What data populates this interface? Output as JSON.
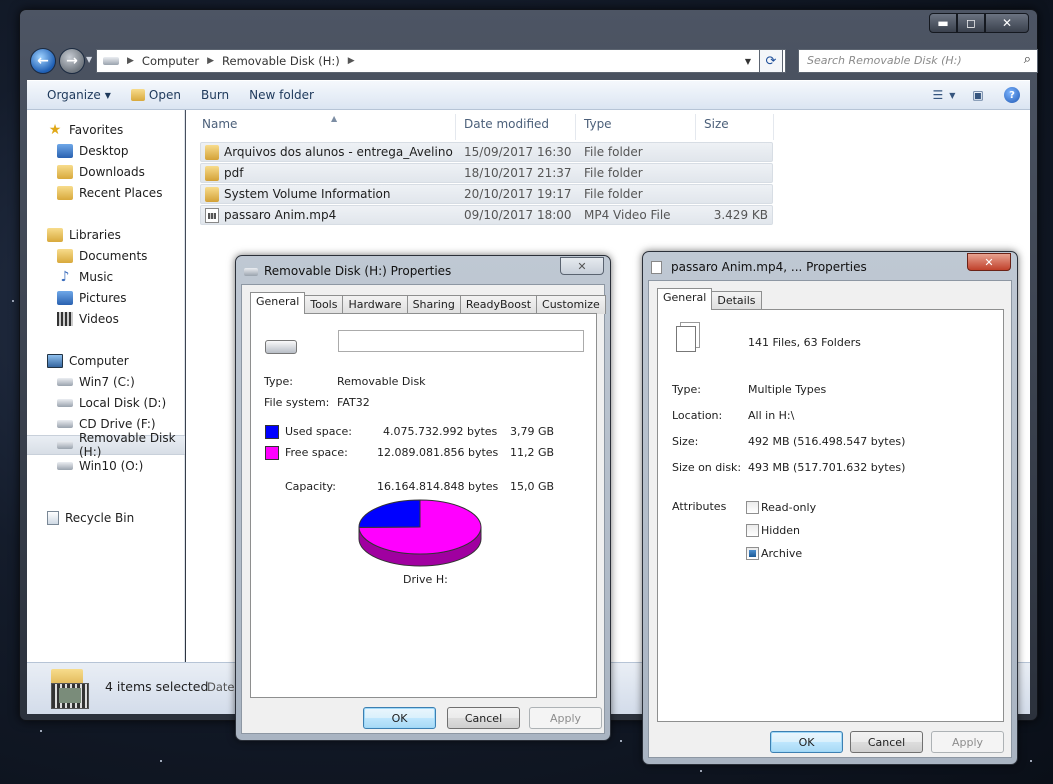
{
  "explorer": {
    "caption_buttons": {
      "minimize": "▬",
      "maximize": "◻",
      "close": "✕"
    },
    "address": {
      "crumbs": [
        "Computer",
        "Removable Disk (H:)"
      ]
    },
    "search_placeholder": "Search Removable Disk (H:)",
    "toolbar": {
      "organize": "Organize",
      "open": "Open",
      "burn": "Burn",
      "new_folder": "New folder"
    },
    "nav": {
      "favorites": "Favorites",
      "desktop": "Desktop",
      "downloads": "Downloads",
      "recent": "Recent Places",
      "libraries": "Libraries",
      "documents": "Documents",
      "music": "Music",
      "pictures": "Pictures",
      "videos": "Videos",
      "computer": "Computer",
      "win7": "Win7 (C:)",
      "local": "Local Disk (D:)",
      "cd": "CD Drive (F:)",
      "removable": "Removable Disk (H:)",
      "win10": "Win10 (O:)",
      "recycle": "Recycle Bin"
    },
    "columns": {
      "name": "Name",
      "date": "Date modified",
      "type": "Type",
      "size": "Size"
    },
    "files": [
      {
        "name": "Arquivos dos alunos - entrega_Avelino",
        "date": "15/09/2017 16:30",
        "type": "File folder",
        "size": ""
      },
      {
        "name": "pdf",
        "date": "18/10/2017 21:37",
        "type": "File folder",
        "size": ""
      },
      {
        "name": "System Volume Information",
        "date": "20/10/2017 19:17",
        "type": "File folder",
        "size": ""
      },
      {
        "name": "passaro Anim.mp4",
        "date": "09/10/2017 18:00",
        "type": "MP4 Video File",
        "size": "3.429 KB"
      }
    ],
    "status": {
      "selected": "4 items selected",
      "date_label": "Date m"
    }
  },
  "disk_dialog": {
    "title": "Removable Disk (H:) Properties",
    "close": "✕",
    "tabs": [
      "General",
      "Tools",
      "Hardware",
      "Sharing",
      "ReadyBoost",
      "Customize"
    ],
    "name_value": "",
    "type_label": "Type:",
    "type_value": "Removable Disk",
    "fs_label": "File system:",
    "fs_value": "FAT32",
    "used_label": "Used space:",
    "used_bytes": "4.075.732.992 bytes",
    "used_gb": "3,79 GB",
    "free_label": "Free space:",
    "free_bytes": "12.089.081.856 bytes",
    "free_gb": "11,2 GB",
    "cap_label": "Capacity:",
    "cap_bytes": "16.164.814.848 bytes",
    "cap_gb": "15,0 GB",
    "drive_label": "Drive H:",
    "used_color": "#0000ff",
    "free_color": "#ff00ff",
    "used_fraction": 0.252,
    "ok": "OK",
    "cancel": "Cancel",
    "apply": "Apply"
  },
  "file_dialog": {
    "title": "passaro Anim.mp4, ... Properties",
    "close": "✕",
    "tabs": [
      "General",
      "Details"
    ],
    "summary": "141 Files, 63 Folders",
    "type_label": "Type:",
    "type_value": "Multiple Types",
    "loc_label": "Location:",
    "loc_value": "All in H:\\",
    "size_label": "Size:",
    "size_value": "492 MB (516.498.547 bytes)",
    "disk_label": "Size on disk:",
    "disk_value": "493 MB (517.701.632 bytes)",
    "attr_label": "Attributes",
    "readonly": "Read-only",
    "hidden": "Hidden",
    "archive": "Archive",
    "ok": "OK",
    "cancel": "Cancel",
    "apply": "Apply"
  }
}
